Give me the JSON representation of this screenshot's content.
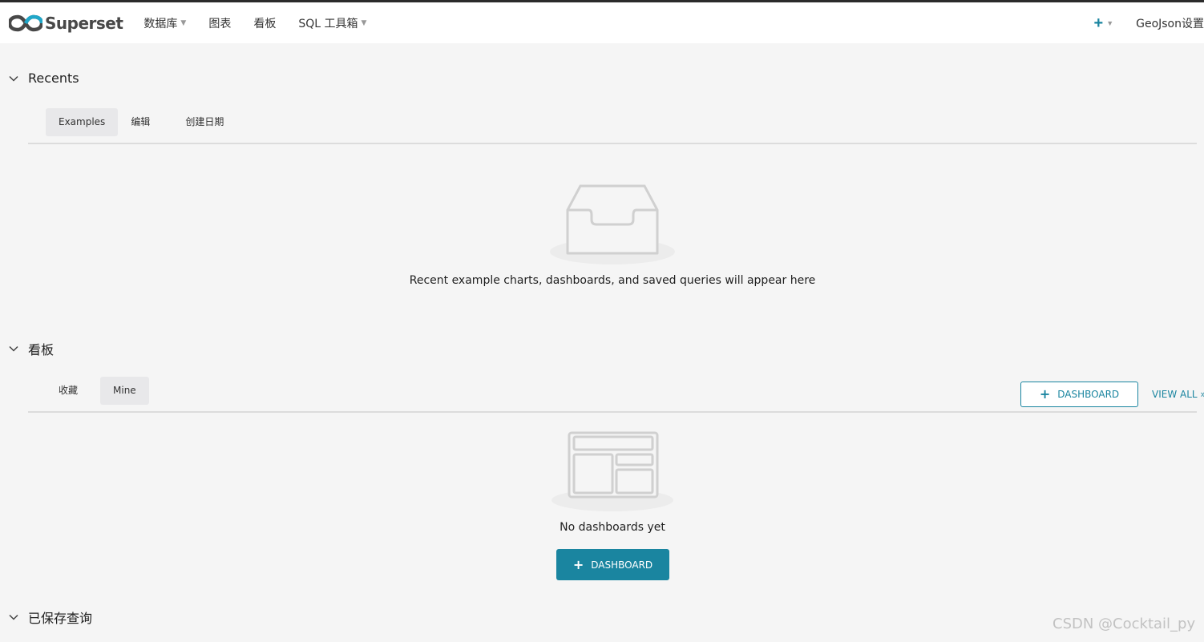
{
  "brand": {
    "name": "Superset",
    "logo_icon": "superset-logo-icon"
  },
  "nav": {
    "items": [
      {
        "label": "数据库",
        "has_dropdown": true
      },
      {
        "label": "图表",
        "has_dropdown": false
      },
      {
        "label": "看板",
        "has_dropdown": false
      },
      {
        "label": "SQL 工具箱",
        "has_dropdown": true
      }
    ],
    "plus_menu": {
      "icon": "plus-icon",
      "has_dropdown": true
    },
    "user_menu": "GeoJson设置"
  },
  "recents": {
    "title": "Recents",
    "tabs": [
      {
        "label": "Examples",
        "active": true
      },
      {
        "label": "编辑",
        "active": false
      },
      {
        "label": "创建日期",
        "active": false
      }
    ],
    "empty_icon": "empty-inbox-icon",
    "empty_text": "Recent example charts, dashboards, and saved queries will appear here"
  },
  "dashboards": {
    "title": "看板",
    "tabs": [
      {
        "label": "收藏",
        "active": false
      },
      {
        "label": "Mine",
        "active": true
      }
    ],
    "add_button": "DASHBOARD",
    "view_all": "VIEW ALL »",
    "empty_icon": "empty-dashboard-icon",
    "empty_text": "No dashboards yet",
    "empty_button": "DASHBOARD"
  },
  "saved_queries": {
    "title": "已保存查询"
  },
  "watermark": "CSDN @Cocktail_py",
  "colors": {
    "accent": "#1a85a0",
    "background": "#f5f5f5",
    "navbar": "#ffffff",
    "tab_active": "#e8e8ea"
  }
}
